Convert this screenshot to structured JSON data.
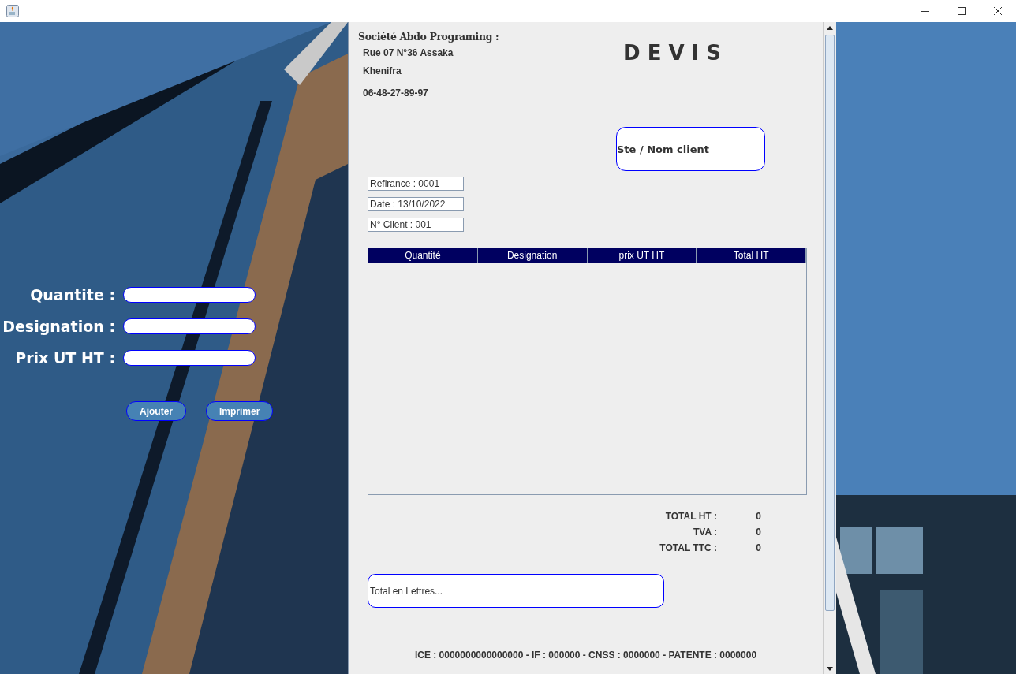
{
  "form": {
    "fields": [
      {
        "label": "Quantite :"
      },
      {
        "label": "Designation :"
      },
      {
        "label": "Prix UT HT :"
      }
    ],
    "buttons": [
      "Ajouter",
      "Imprimer"
    ]
  },
  "document": {
    "company": "Société Abdo Programing :",
    "address": [
      "Rue 07 N°36 Assaka",
      "Khenifra",
      "06-48-27-89-97"
    ],
    "title": "D E V I S",
    "client": "Ste / Nom client",
    "info": [
      "Refirance : 0001",
      "Date : 13/10/2022",
      "N° Client : 001"
    ],
    "table": {
      "columns": [
        "Quantité",
        "Designation",
        "prix UT HT",
        "Total HT"
      ]
    },
    "totals": [
      {
        "label": "TOTAL HT :",
        "value": "0"
      },
      {
        "label": "TVA :",
        "value": "0"
      },
      {
        "label": "TOTAL TTC :",
        "value": "0"
      }
    ],
    "amount_in_words": "Total en Lettres...",
    "footer": "ICE : 0000000000000000 - IF : 000000 - CNSS : 0000000 - PATENTE : 0000000"
  }
}
